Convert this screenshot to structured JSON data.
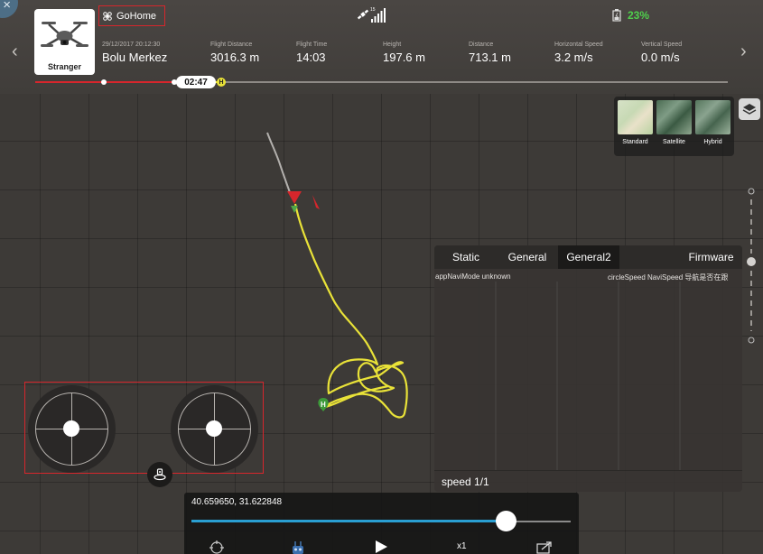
{
  "header": {
    "close_icon": "×",
    "drone_name": "Stranger",
    "mode_label": "GoHome",
    "satellite_count": "15",
    "battery_percent": "23%",
    "stats": [
      {
        "label": "29/12/2017 20:12:30",
        "value": "Bolu Merkez"
      },
      {
        "label": "Flight Distance",
        "value": "3016.3 m"
      },
      {
        "label": "Flight Time",
        "value": "14:03"
      },
      {
        "label": "Height",
        "value": "197.6 m"
      },
      {
        "label": "Distance",
        "value": "713.1 m"
      },
      {
        "label": "Horizontal Speed",
        "value": "3.2 m/s"
      },
      {
        "label": "Vertical Speed",
        "value": "0.0 m/s"
      }
    ]
  },
  "timeline": {
    "time_label": "02:47",
    "home_marker": "H",
    "progress": 0.27
  },
  "map_types": [
    {
      "label": "Standard"
    },
    {
      "label": "Satellite"
    },
    {
      "label": "Hybrid"
    }
  ],
  "info_panel": {
    "tabs": [
      "Static",
      "General",
      "General2",
      "Firmware"
    ],
    "active_tab": "General2",
    "left_text": "appNaviMode unknown",
    "right_text": "circleSpeed NaviSpeed 导航是否在跟",
    "speed_label": "speed 1/1"
  },
  "map": {
    "home_marker": "H"
  },
  "playback": {
    "coordinates": "40.659650, 31.622848",
    "speed_multiplier": "x1",
    "progress": 0.83
  },
  "colors": {
    "flight_path": "#e9e238",
    "accent_red": "#d6262c",
    "battery_green": "#4fcf4c",
    "playback_blue": "#2a9fd2",
    "home_green": "#3d9a3a"
  }
}
